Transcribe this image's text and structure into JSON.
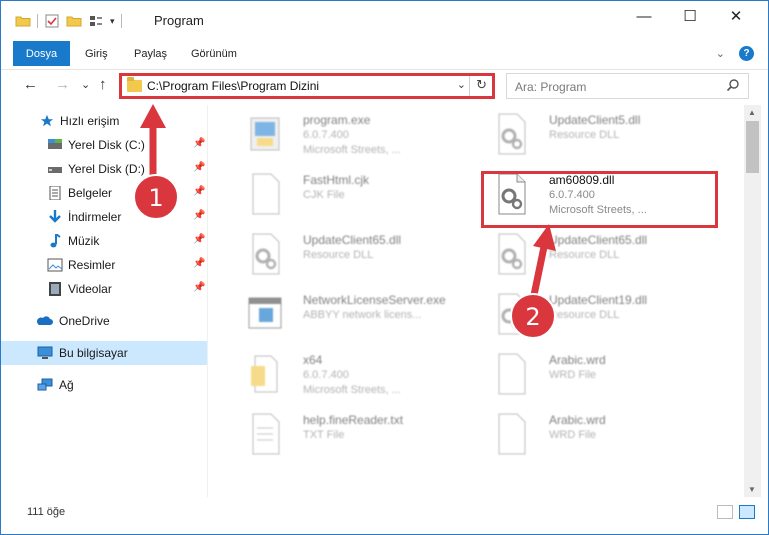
{
  "window": {
    "title": "Program",
    "controls": {
      "minimize": "—",
      "maximize": "☐",
      "close": "✕"
    }
  },
  "ribbon": {
    "tabs": [
      {
        "label": "Dosya",
        "active": true
      },
      {
        "label": "Giriş"
      },
      {
        "label": "Paylaş"
      },
      {
        "label": "Görünüm"
      }
    ]
  },
  "nav": {
    "back": "←",
    "forward": "→",
    "recent": "⌄",
    "up": "↑",
    "address": "C:\\Program Files\\Program Dizini",
    "search_placeholder": "Ara: Program"
  },
  "sidebar": {
    "items": [
      {
        "label": "Hızlı erişim",
        "icon": "star-icon",
        "color": "#1979ca"
      },
      {
        "label": "Yerel Disk (C:)",
        "icon": "disk-c-icon",
        "pinned": true
      },
      {
        "label": "Yerel Disk (D:)",
        "icon": "disk-d-icon",
        "pinned": true
      },
      {
        "label": "Belgeler",
        "icon": "documents-icon",
        "pinned": true
      },
      {
        "label": "İndirmeler",
        "icon": "downloads-icon",
        "pinned": true
      },
      {
        "label": "Müzik",
        "icon": "music-icon",
        "pinned": true
      },
      {
        "label": "Resimler",
        "icon": "pictures-icon",
        "pinned": true
      },
      {
        "label": "Videolar",
        "icon": "videos-icon",
        "pinned": true
      },
      {
        "label": "OneDrive",
        "icon": "onedrive-icon"
      },
      {
        "label": "Bu bilgisayar",
        "icon": "this-pc-icon",
        "selected": true
      },
      {
        "label": "Ağ",
        "icon": "network-icon"
      }
    ]
  },
  "files": [
    {
      "name": "program.exe",
      "line1": "6.0.7.400",
      "line2": "Microsoft Streets, ...",
      "icon": "exe-icon"
    },
    {
      "name": "UpdateClient5.dll",
      "line1": "Resource DLL",
      "line2": "",
      "icon": "dll-icon"
    },
    {
      "name": "FastHtml.cjk",
      "line1": "CJK File",
      "line2": "",
      "icon": "blank-file-icon"
    },
    {
      "name": "am60809.dll",
      "line1": "6.0.7.400",
      "line2": "Microsoft Streets, ...",
      "icon": "dll-icon",
      "highlighted": true
    },
    {
      "name": "UpdateClient65.dll",
      "line1": "Resource DLL",
      "line2": "",
      "icon": "dll-icon"
    },
    {
      "name": "UpdateClient65.dll",
      "line1": "Resource DLL",
      "line2": "",
      "icon": "dll-icon"
    },
    {
      "name": "NetworkLicenseServer.exe",
      "line1": "ABBYY network licens...",
      "line2": "",
      "icon": "app-window-icon"
    },
    {
      "name": "UpdateClient19.dll",
      "line1": "Resource DLL",
      "line2": "",
      "icon": "dll-icon"
    },
    {
      "name": "x64",
      "line1": "6.0.7.400",
      "line2": "Microsoft Streets, ...",
      "icon": "folder-file-icon"
    },
    {
      "name": "Arabic.wrd",
      "line1": "WRD File",
      "line2": "",
      "icon": "blank-file-icon"
    },
    {
      "name": "help.fineReader.txt",
      "line1": "TXT File",
      "line2": "",
      "icon": "text-file-icon"
    },
    {
      "name": "Arabic.wrd",
      "line1": "WRD File",
      "line2": "",
      "icon": "blank-file-icon"
    }
  ],
  "status": {
    "item_count": "111 öğe"
  },
  "annotations": [
    {
      "label": "1",
      "color": "#d9363e"
    },
    {
      "label": "2",
      "color": "#d9363e"
    }
  ],
  "colors": {
    "accent": "#1979ca",
    "annotation": "#d9363e",
    "selection": "#cce8ff"
  }
}
